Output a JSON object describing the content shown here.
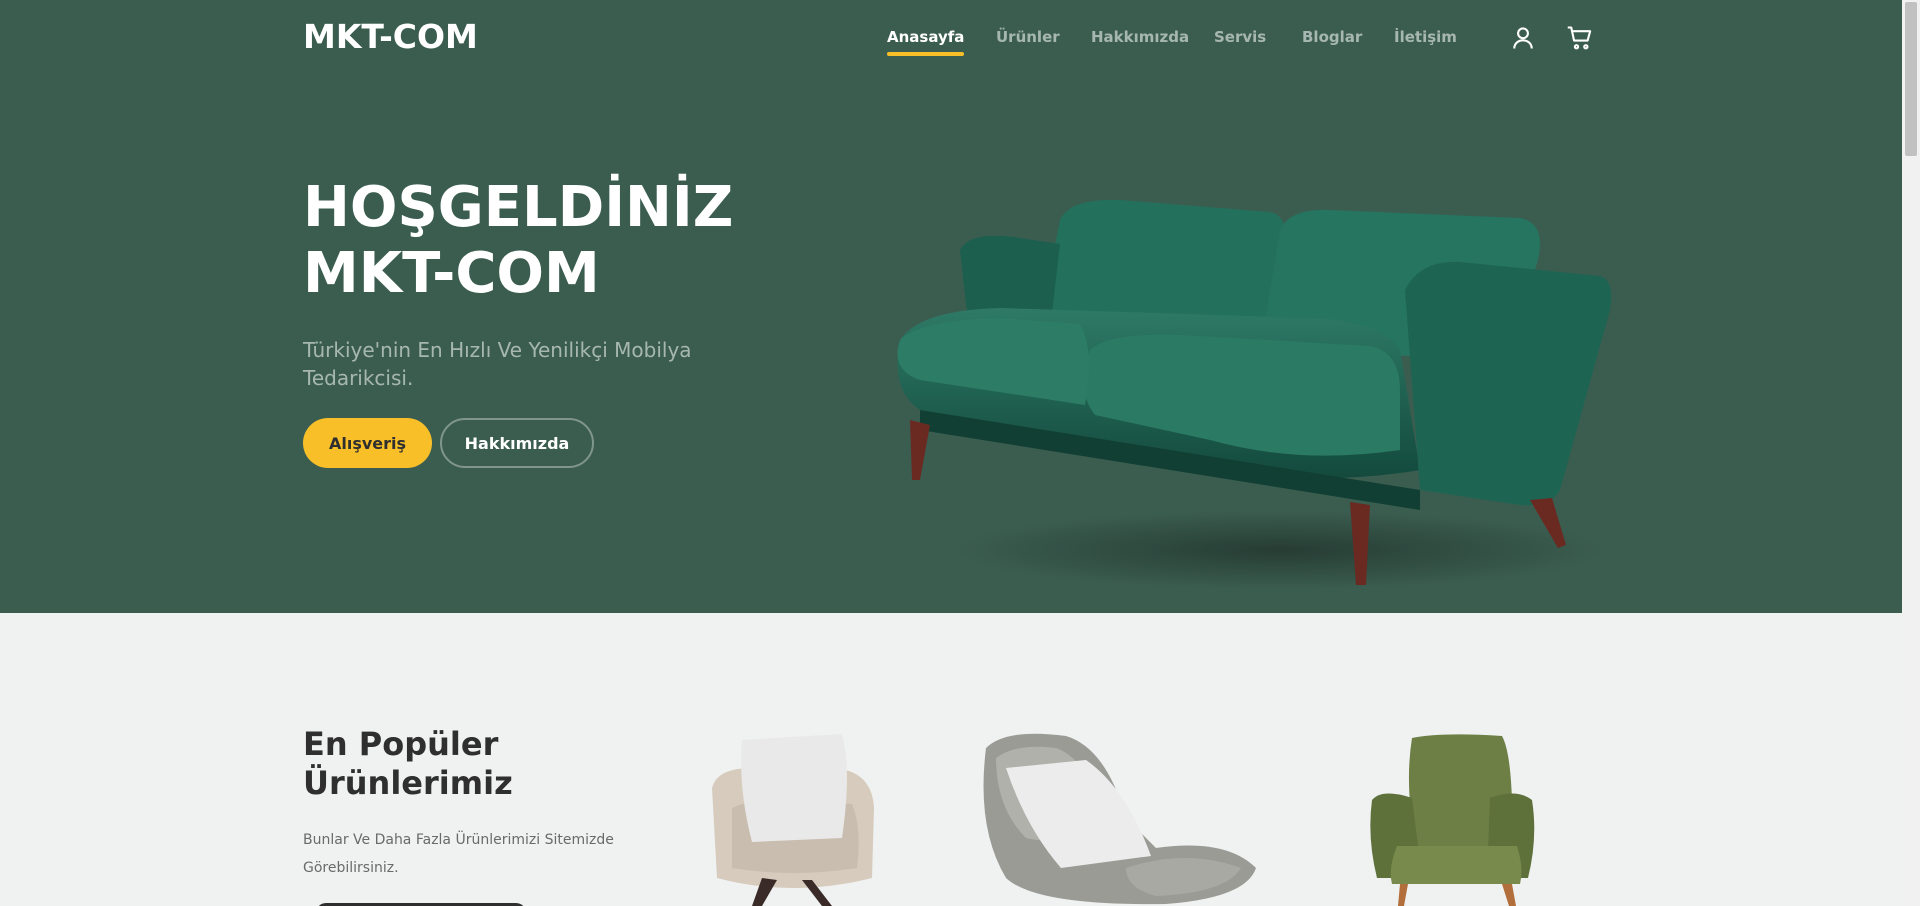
{
  "header": {
    "brand": "MKT-COM",
    "nav": [
      {
        "label": "Anasayfa",
        "active": true
      },
      {
        "label": "Ürünler",
        "active": false
      },
      {
        "label": "Hakkımızda",
        "active": false
      },
      {
        "label": "Servis",
        "active": false
      },
      {
        "label": "Bloglar",
        "active": false
      },
      {
        "label": "İletişim",
        "active": false
      }
    ],
    "icons": [
      "user-icon",
      "cart-icon"
    ]
  },
  "hero": {
    "title_line1": "HOŞGELDİNİZ",
    "title_line2": "MKT-COM",
    "subtitle": "Türkiye'nin En Hızlı Ve Yenilikçi Mobilya Tedarikcisi.",
    "primary_button": "Alışveriş",
    "secondary_button": "Hakkımızda"
  },
  "popular": {
    "title_line1": "En Popüler",
    "title_line2": "Ürünlerimiz",
    "description": "Bunlar Ve Daha Fazla Ürünlerimizi Sitemizde Görebilirsiniz."
  },
  "colors": {
    "hero_bg": "#3b5d50",
    "accent": "#f9bf29",
    "page_bg": "#eff2f1"
  }
}
